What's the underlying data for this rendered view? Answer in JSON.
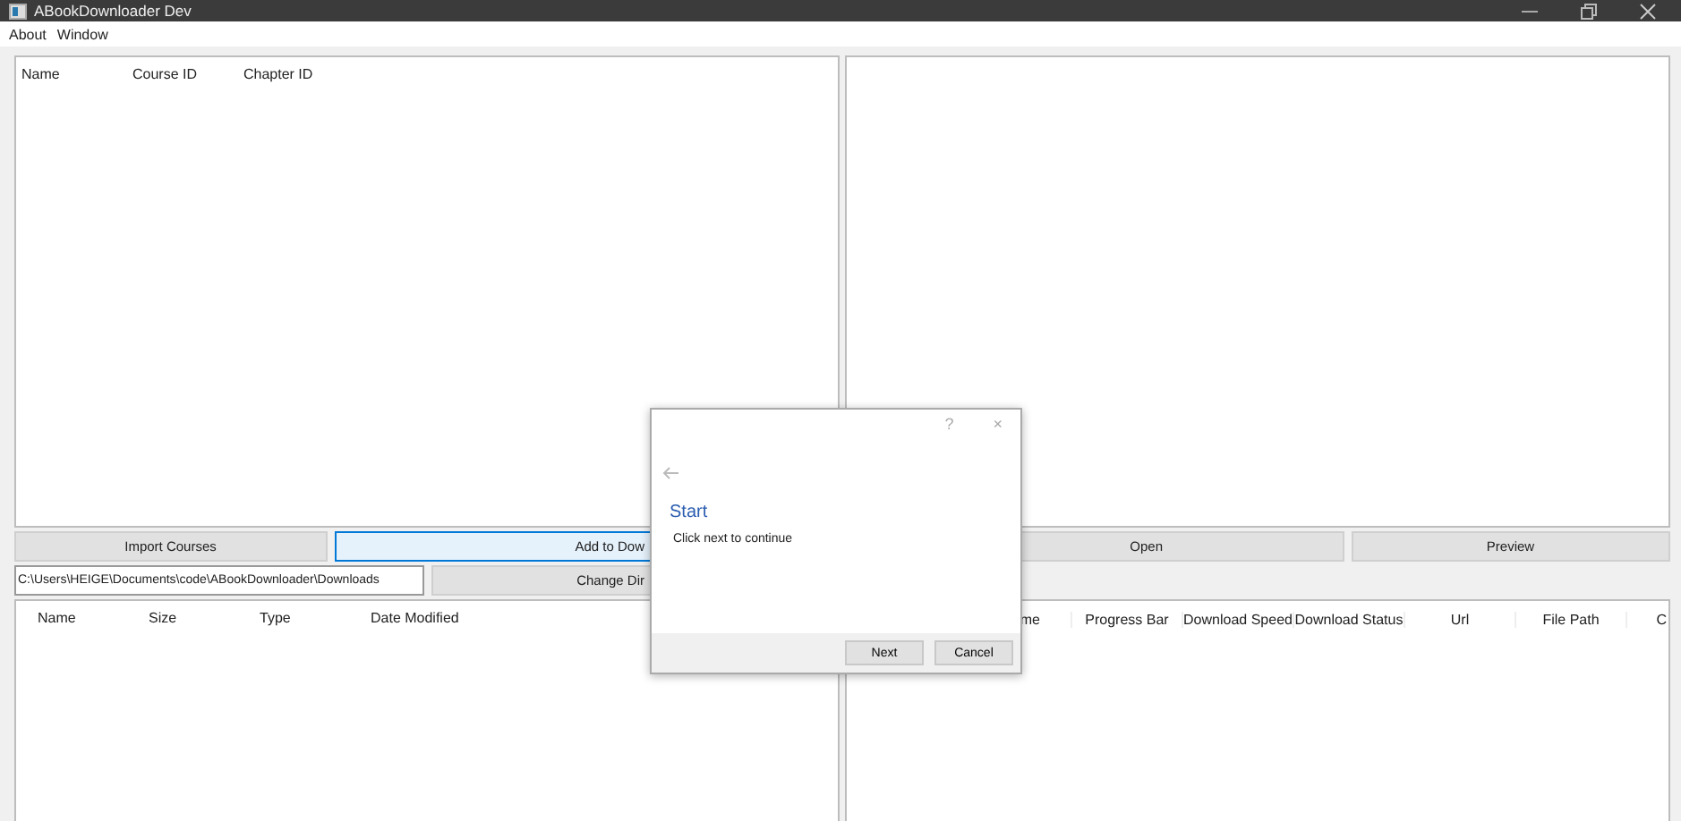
{
  "window": {
    "title": "ABookDownloader Dev"
  },
  "menu": [
    "About",
    "Window"
  ],
  "courses_table": {
    "columns": [
      "Name",
      "Course ID",
      "Chapter ID"
    ]
  },
  "buttons_left": [
    {
      "label": "Import Courses",
      "selected": false
    },
    {
      "label": "Add to Dow",
      "selected": true
    }
  ],
  "path_field": {
    "value": "C:\\Users\\HEIGE\\Documents\\code\\ABookDownloader\\Downloads"
  },
  "change_dir_button": "Change Dir",
  "files_table": {
    "columns": [
      "Name",
      "Size",
      "Type",
      "Date Modified"
    ]
  },
  "buttons_right": [
    "Open",
    "Preview"
  ],
  "downloads_table": {
    "columns": [
      "me",
      "Progress Bar",
      "Download Speed",
      "Download Status",
      "Url",
      "File Path",
      "C"
    ]
  },
  "dialog": {
    "help": "?",
    "close": "×",
    "heading": "Start",
    "message": "Click next to continue",
    "buttons": [
      "Next",
      "Cancel"
    ]
  }
}
